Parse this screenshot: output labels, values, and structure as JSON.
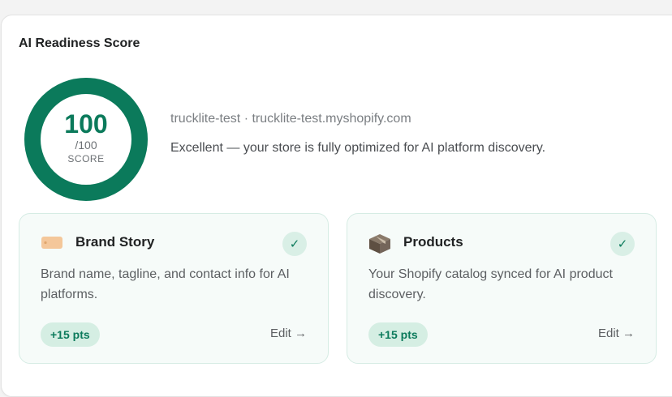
{
  "card": {
    "title": "AI Readiness Score"
  },
  "score": {
    "value": "100",
    "max": "/100",
    "label": "SCORE",
    "fraction": 1.0
  },
  "store": {
    "line": "trucklite-test · trucklite-test.myshopify.com",
    "status": "Excellent — your store is fully optimized for AI platform discovery."
  },
  "tiles": [
    {
      "icon": "brand-tag-icon",
      "title": "Brand Story",
      "check": "✓",
      "description": "Brand name, tagline, and contact info for AI platforms.",
      "points": "+15 pts",
      "edit": "Edit →"
    },
    {
      "icon": "package-box-icon",
      "title": "Products",
      "check": "✓",
      "description": "Your Shopify catalog synced for AI product discovery.",
      "points": "+15 pts",
      "edit": "Edit →"
    }
  ],
  "colors": {
    "accent": "#0b7a5b",
    "ring_track": "#e3efe9",
    "tile_bg": "#f6fbf9"
  }
}
